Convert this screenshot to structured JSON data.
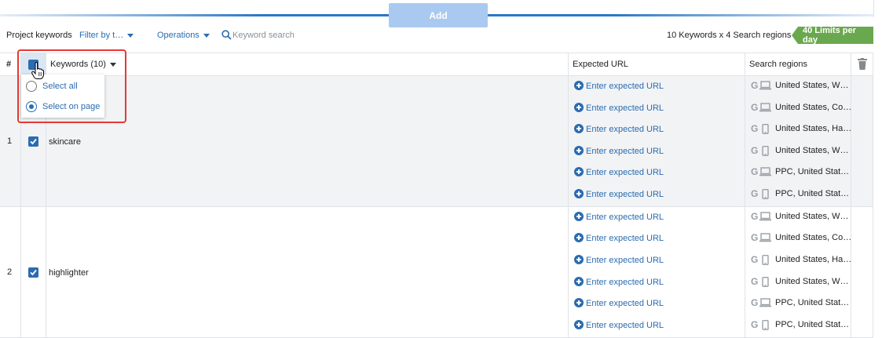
{
  "add_button": "Add",
  "toolbar": {
    "title": "Project keywords",
    "filter": "Filter by t…",
    "operations": "Operations",
    "search_placeholder": "Keyword search",
    "summary": "10 Keywords x 4 Search regions =",
    "limits": "40 Limits per day"
  },
  "table": {
    "headers": {
      "num": "#",
      "keywords": "Keywords (10)",
      "url": "Expected URL",
      "regions": "Search regions"
    },
    "rows": [
      {
        "num": "1",
        "keyword": "skincare",
        "checked": true,
        "subrows": [
          {
            "url": "Enter expected URL",
            "engine": "G",
            "device": "desktop",
            "region": "United States, W…"
          },
          {
            "url": "Enter expected URL",
            "engine": "G",
            "device": "desktop",
            "region": "United States, Co…"
          },
          {
            "url": "Enter expected URL",
            "engine": "G",
            "device": "mobile",
            "region": "United States, Ha…"
          },
          {
            "url": "Enter expected URL",
            "engine": "G",
            "device": "mobile",
            "region": "United States, W…"
          },
          {
            "url": "Enter expected URL",
            "engine": "G",
            "device": "desktop",
            "region": "PPC, United Stat…"
          },
          {
            "url": "Enter expected URL",
            "engine": "G",
            "device": "mobile",
            "region": "PPC, United Stat…"
          }
        ]
      },
      {
        "num": "2",
        "keyword": "highlighter",
        "checked": true,
        "subrows": [
          {
            "url": "Enter expected URL",
            "engine": "G",
            "device": "desktop",
            "region": "United States, W…"
          },
          {
            "url": "Enter expected URL",
            "engine": "G",
            "device": "desktop",
            "region": "United States, Co…"
          },
          {
            "url": "Enter expected URL",
            "engine": "G",
            "device": "mobile",
            "region": "United States, Ha…"
          },
          {
            "url": "Enter expected URL",
            "engine": "G",
            "device": "mobile",
            "region": "United States, W…"
          },
          {
            "url": "Enter expected URL",
            "engine": "G",
            "device": "desktop",
            "region": "PPC, United Stat…"
          },
          {
            "url": "Enter expected URL",
            "engine": "G",
            "device": "mobile",
            "region": "PPC, United Stat…"
          }
        ]
      }
    ]
  },
  "select_menu": {
    "options": [
      {
        "label": "Select all",
        "selected": false
      },
      {
        "label": "Select on page",
        "selected": true
      }
    ]
  },
  "colors": {
    "accent": "#2b6cb0",
    "limits_badge": "#6aa84f",
    "highlight": "#e53935"
  }
}
